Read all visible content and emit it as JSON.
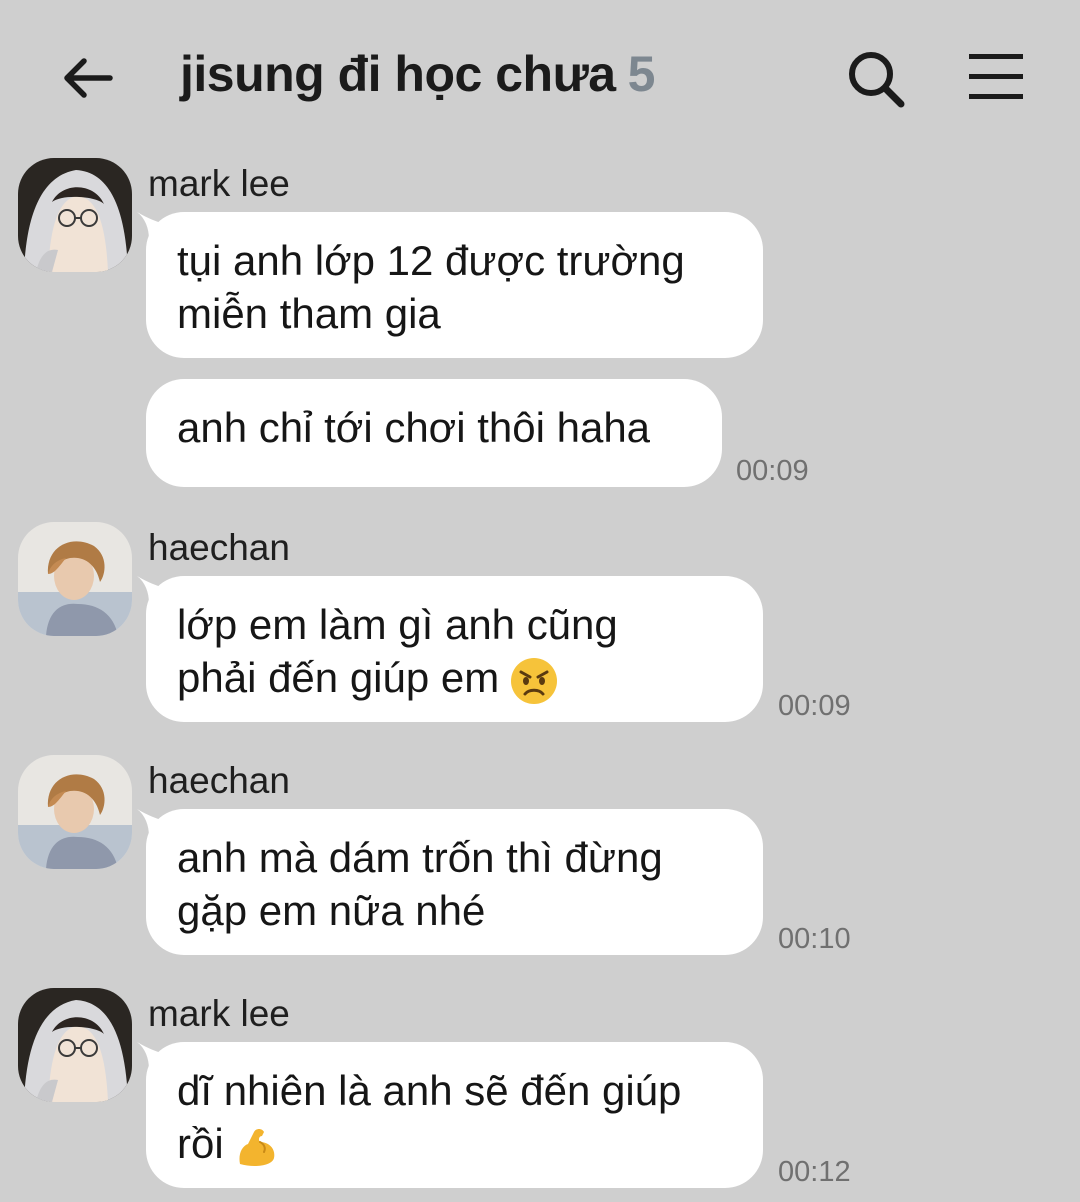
{
  "header": {
    "title": "jisung đi học chưa",
    "member_count": "5"
  },
  "messages": [
    {
      "sender": "mark lee",
      "avatar": "mark-lee-avatar",
      "bubbles": [
        {
          "lines": [
            "tụi anh lớp 12 được trường",
            "miễn tham gia"
          ]
        },
        {
          "lines": [
            "anh chỉ tới chơi thôi haha"
          ],
          "time": "00:09"
        }
      ]
    },
    {
      "sender": "haechan",
      "avatar": "haechan-avatar",
      "bubbles": [
        {
          "lines": [
            "lớp em làm gì anh cũng",
            "phải đến giúp em"
          ],
          "emoji": "angry-face-emoji",
          "time": "00:09"
        }
      ]
    },
    {
      "sender": "haechan",
      "avatar": "haechan-avatar",
      "bubbles": [
        {
          "lines": [
            "anh mà dám trốn thì đừng",
            "gặp em nữa nhé"
          ],
          "time": "00:10"
        }
      ]
    },
    {
      "sender": "mark lee",
      "avatar": "mark-lee-avatar",
      "bubbles": [
        {
          "lines": [
            "dĩ nhiên là anh sẽ đến giúp",
            "rồi"
          ],
          "emoji": "flexed-biceps-emoji",
          "time": "00:12"
        }
      ]
    }
  ],
  "colors": {
    "background": "#cfcfcf",
    "bubble": "#ffffff",
    "title": "#1b1b1b",
    "count": "#7d8790",
    "time": "#707070"
  }
}
